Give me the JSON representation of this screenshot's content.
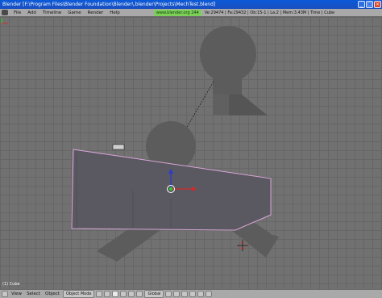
{
  "window": {
    "title": "Blender [F:\\Program Files\\Blender Foundation\\Blender\\.blender\\Projects\\MechTest.blend]",
    "buttons": [
      "_",
      "□",
      "×"
    ]
  },
  "menubar": {
    "items": [
      "File",
      "Add",
      "Timeline",
      "Game",
      "Render",
      "Help"
    ],
    "url": "www.blender.org 244",
    "stats": "Ve:29474 | Fa:29432 | Ob:15-1 | La:2 | Mem:3.43M | Time | Cube"
  },
  "viewport": {
    "object_label": "(1) Cube",
    "colors": {
      "background": "#717171",
      "grid": "#666666",
      "mesh_face": "#5a5860",
      "mesh_outline": "#d9a6d9",
      "gray_object": "#5c5c5c",
      "widget_red": "#d22a2a",
      "widget_blue": "#2a3ad2",
      "widget_green": "#2ad02a"
    }
  },
  "statusbar": {
    "view": "View",
    "select": "Select",
    "object": "Object",
    "mode": "Object Mode",
    "pivot": "Global"
  }
}
